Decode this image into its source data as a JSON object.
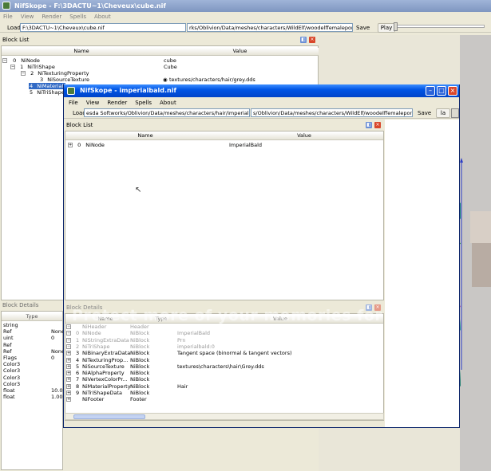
{
  "bg_window": {
    "title": "NifSkope - F:\\3DACTU~1\\Cheveux\\cube.nif",
    "menu": [
      "File",
      "View",
      "Render",
      "Spells",
      "About"
    ],
    "load_label": "Load",
    "load_path": "F:\\3DACTU~1\\Cheveux\\cube.nif",
    "save_path": "rks/Oblivion/Data/meshes/characters/WildElf/woodelffemaleponytail.nif",
    "save_label": "Save",
    "play_label": "Play",
    "block_list": {
      "title": "Block List",
      "col_name": "Name",
      "col_value": "Value",
      "rows": [
        {
          "num": "0",
          "name": "NiNode",
          "value": "cube"
        },
        {
          "num": "1",
          "name": "NiTriShape",
          "value": "Cube"
        },
        {
          "num": "2",
          "name": "NiTexturingProperty",
          "value": ""
        },
        {
          "num": "3",
          "name": "NiSourceTexture",
          "value": "textures/characters/hair/grey.dds"
        },
        {
          "num": "4",
          "name": "NiMaterialPr",
          "value": ""
        },
        {
          "num": "5",
          "name": "NiTriShapeI",
          "value": ""
        }
      ]
    },
    "block_details": {
      "title": "Block Details",
      "col_type": "Type",
      "types": [
        "string",
        "Ref",
        "uint",
        "Ref",
        "Ref",
        "Flags",
        "Color3",
        "Color3",
        "Color3",
        "Color3",
        "float",
        "float"
      ],
      "values": [
        "",
        "None",
        "0",
        "",
        "None",
        "0",
        "",
        "",
        "",
        "",
        "10.0",
        "1.00"
      ]
    }
  },
  "fg_window": {
    "title": "NifSkope - imperialbald.nif",
    "menu": [
      "File",
      "View",
      "Render",
      "Spells",
      "About"
    ],
    "load_label": "Load",
    "load_path": "esda Softworks/Oblivion/Data/meshes/characters/hair/imperialbald.nif",
    "save_path": "s/Oblivion/Data/meshes/characters/WildElf/woodelffemaleponytail.nif",
    "save_label": "Save",
    "play_label": "la",
    "block_list": {
      "title": "Block List",
      "col_name": "Name",
      "col_value": "Value",
      "rows": [
        {
          "num": "0",
          "name": "NiNode",
          "value": "ImperialBald"
        }
      ]
    },
    "block_details": {
      "title": "Block Details",
      "col_name": "Name",
      "col_type": "Type",
      "col_value": "Value",
      "rows": [
        {
          "num": "",
          "name": "NiHeader",
          "type": "Header",
          "value": "",
          "gray": true
        },
        {
          "num": "0",
          "name": "NiNode",
          "type": "NiBlock",
          "value": "ImperialBald",
          "gray": true
        },
        {
          "num": "1",
          "name": "NiStringExtraData",
          "type": "NiBlock",
          "value": "Prn",
          "gray": true
        },
        {
          "num": "2",
          "name": "NiTriShape",
          "type": "NiBlock",
          "value": "imperialbald:0",
          "gray": true
        },
        {
          "num": "3",
          "name": "NiBinaryExtraData",
          "type": "NiBlock",
          "value": "Tangent space (binormal & tangent vectors)",
          "gray": false
        },
        {
          "num": "4",
          "name": "NiTexturingProp...",
          "type": "NiBlock",
          "value": "",
          "gray": false
        },
        {
          "num": "5",
          "name": "NiSourceTexture",
          "type": "NiBlock",
          "value": "textures\\characters\\hair\\Grey.dds",
          "gray": false
        },
        {
          "num": "6",
          "name": "NiAlphaProperty",
          "type": "NiBlock",
          "value": "",
          "gray": false
        },
        {
          "num": "7",
          "name": "NiVertexColorPr...",
          "type": "NiBlock",
          "value": "",
          "gray": false
        },
        {
          "num": "8",
          "name": "NiMaterialProperty",
          "type": "NiBlock",
          "value": "Hair",
          "gray": false
        },
        {
          "num": "9",
          "name": "NiTriShapeData",
          "type": "NiBlock",
          "value": "",
          "gray": false
        },
        {
          "num": "",
          "name": "NiFooter",
          "type": "Footer",
          "value": "",
          "gray": false
        }
      ]
    }
  },
  "watermark": "Protect more of your memories for less!",
  "colors": {
    "title_active": "#0055e5",
    "title_inactive": "#7f96c0",
    "close_red": "#d9472b"
  }
}
